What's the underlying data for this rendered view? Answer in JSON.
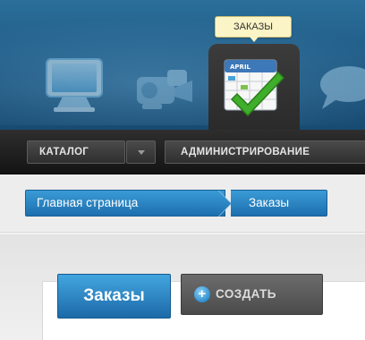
{
  "header": {
    "tooltip": "ЗАКАЗЫ",
    "icons": [
      "monitor-icon",
      "camera-icon",
      "calendar-check-icon",
      "chat-bubble-icon"
    ],
    "calendar_month": "APRIL"
  },
  "menu": {
    "catalog_label": "КАТАЛОГ",
    "admin_label": "АДМИНИСТРИРОВАНИЕ"
  },
  "breadcrumb": {
    "home": "Главная страница",
    "current": "Заказы"
  },
  "page": {
    "title": "Заказы",
    "create_label": "СОЗДАТЬ",
    "create_icon": "plus-circle-icon"
  },
  "colors": {
    "accent_blue": "#1d6fae",
    "menubar_dark": "#1e1e1e",
    "tooltip_bg": "#fbf4c6"
  }
}
